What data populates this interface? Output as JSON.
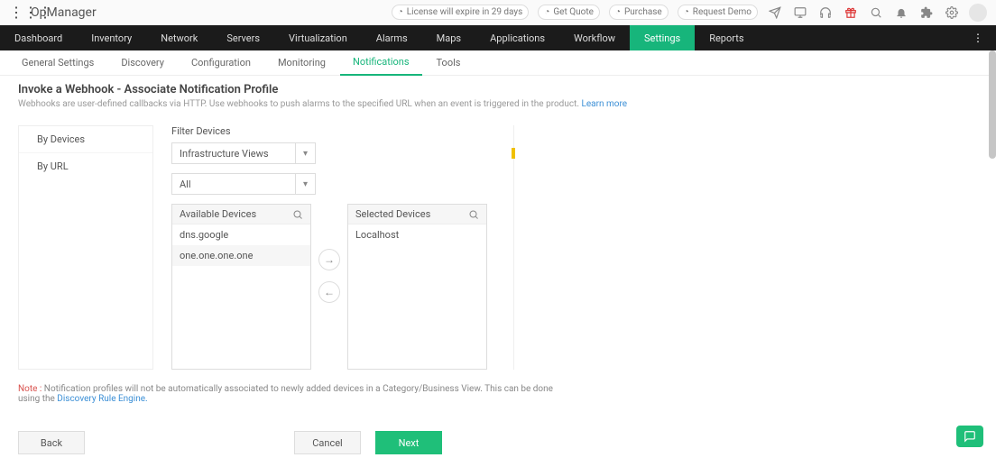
{
  "brand": {
    "name": "OpManager"
  },
  "top_links": {
    "license": "License will expire in 29 days",
    "quote": "Get Quote",
    "purchase": "Purchase",
    "demo": "Request Demo"
  },
  "mainnav": {
    "items": [
      "Dashboard",
      "Inventory",
      "Network",
      "Servers",
      "Virtualization",
      "Alarms",
      "Maps",
      "Applications",
      "Workflow",
      "Settings",
      "Reports"
    ],
    "active_index": 9
  },
  "subnav": {
    "items": [
      "General Settings",
      "Discovery",
      "Configuration",
      "Monitoring",
      "Notifications",
      "Tools"
    ],
    "active_index": 4
  },
  "page": {
    "title": "Invoke a Webhook - Associate Notification Profile",
    "desc": "Webhooks are user-defined callbacks via HTTP. Use webhooks to push alarms to the specified URL when an event is triggered in the product. ",
    "learn_more": "Learn more"
  },
  "left_tabs": {
    "items": [
      "By Devices",
      "By URL"
    ],
    "active_index": 0
  },
  "filter": {
    "label": "Filter Devices",
    "select1": "Infrastructure Views",
    "select2": "All"
  },
  "available": {
    "label": "Available Devices",
    "items": [
      "dns.google",
      "one.one.one.one"
    ]
  },
  "selected": {
    "label": "Selected Devices",
    "items": [
      "Localhost"
    ]
  },
  "note": {
    "prefix": "Note :",
    "text": " Notification profiles will not be automatically associated to newly added devices in a Category/Business View. This can be done using the ",
    "link": "Discovery Rule Engine."
  },
  "buttons": {
    "back": "Back",
    "cancel": "Cancel",
    "next": "Next"
  }
}
